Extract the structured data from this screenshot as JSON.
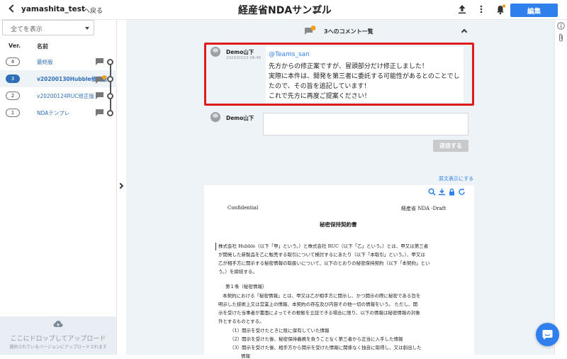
{
  "header": {
    "project": "yamashita_test",
    "back_label": "へ戻る",
    "title": "経産省NDAサンプル",
    "edit_label": "編集",
    "brand_color": "#2f80ed"
  },
  "sidebar": {
    "filter_value": "全てを表示",
    "col_ver": "Ver.",
    "col_name": "名前",
    "versions": [
      {
        "ver": "4",
        "name": "最終版",
        "selected": false
      },
      {
        "ver": "3",
        "name": "v20200130Hubble修正版",
        "selected": true
      },
      {
        "ver": "2",
        "name": "v20200124RUC修正版",
        "selected": false
      },
      {
        "ver": "1",
        "name": "NDAテンプレ",
        "selected": false
      }
    ],
    "drop_title": "ここにドロップしてアップロード",
    "drop_sub": "選択されているバージョンにアップロードされます"
  },
  "thread": {
    "title": "3へのコメント一覧",
    "badge_count": "1",
    "comment": {
      "author": "Demo山下",
      "time": "2020/03/23 08:46",
      "mention": "@Teams_san",
      "lines": [
        "先方からの修正案ですが、冒頭部分だけ修正しました！",
        "実際に本件は、開発を第三者に委託する可能性があるとのことでし",
        "たので、その旨を追記しています！",
        "これで先方に再度ご提案ください！"
      ]
    },
    "reply_author": "Demo山下",
    "send_label": "送信する",
    "highlight_color": "#e01b1b"
  },
  "document": {
    "original_link": "原文表示にする",
    "confidential": "Confidential",
    "draft_label": "経産省 NDA -Draft",
    "heading": "秘密保持契約書",
    "paragraph_lines": [
      "株式会社 Hubble（以下「甲」という。）と株式会社 RUC（以下「乙」という。）とは、甲又は第三者",
      "が開発した新製品を乙に販売する取引について検討するにあたり（以下「本取引」という。）、甲又は",
      "乙が相手方に開示する秘密情報の取扱いについて、以下のとおりの秘密保持契約（以下「本契約」とい",
      "う。）を締結する。"
    ],
    "article_title": "第１条（秘密情報）",
    "article_lines": [
      "本契約における「秘密情報」とは、甲又は乙が相手方に開示し、かつ開示の際に秘密である旨を",
      "明示した技術上又は営業上の情報、本契約の存在及び内容その他一切の情報をいう。 ただし、開",
      "示を受けた当事者が書面によってその根拠を立証できる場合に限り、以下の情報は秘密情報の対象",
      "外とするものとする。"
    ],
    "list_items": [
      "（1）開示を受けたときに既に保有していた情報",
      "（2）開示を受けた後、秘密保持義務を負うことなく第三者から正当に入手した情報",
      "（3）開示を受けた後、相手方から開示を受けた情報に関係なく独自に取得し、又は創出した",
      "情報"
    ]
  }
}
